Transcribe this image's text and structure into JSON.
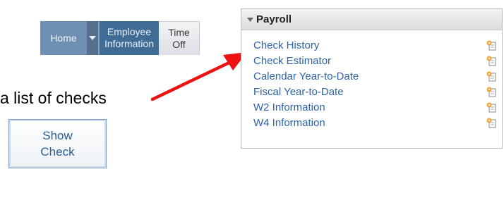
{
  "nav": {
    "home_label": "Home",
    "employee_line1": "Employee",
    "employee_line2": "Information",
    "timeoff_line1": "Time",
    "timeoff_line2": "Off"
  },
  "callout": {
    "text": "a list of checks"
  },
  "show_check_button": {
    "line1": "Show",
    "line2": "Check"
  },
  "payroll_panel": {
    "title": "Payroll",
    "items": [
      {
        "label": "Check History"
      },
      {
        "label": "Check Estimator"
      },
      {
        "label": "Calendar Year-to-Date"
      },
      {
        "label": "Fiscal Year-to-Date"
      },
      {
        "label": "W2 Information"
      },
      {
        "label": "W4 Information"
      }
    ]
  },
  "colors": {
    "arrow": "#ee1111",
    "link": "#2f63a8",
    "nav_active": "#3f6c95"
  }
}
